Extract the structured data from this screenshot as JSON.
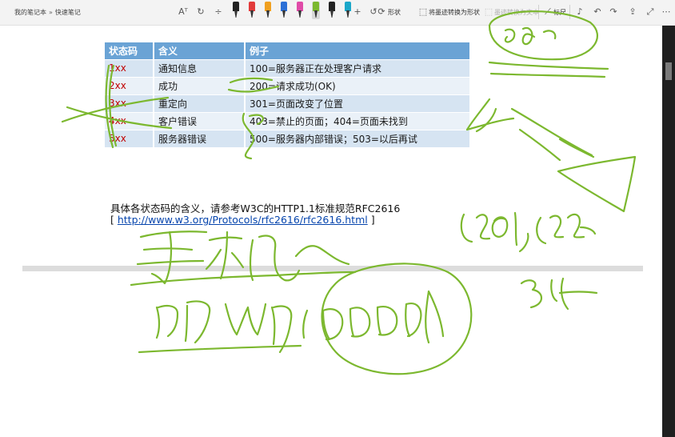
{
  "breadcrumb": {
    "notebook": "我的笔记本",
    "separator": "»",
    "section": "快速笔记"
  },
  "toolbar": {
    "shapes_label": "形状",
    "ink_to_shape_label": "将墨迹转换为形状",
    "ink_to_text_label": "墨迹转换为文本",
    "ruler_label": "标尺",
    "pens": [
      {
        "color": "#222222"
      },
      {
        "color": "#e23b3b"
      },
      {
        "color": "#f0a020"
      },
      {
        "color": "#2b6fd6"
      },
      {
        "color": "#e04ba8"
      },
      {
        "color": "#7cb82f"
      },
      {
        "color": "#222222"
      },
      {
        "color": "#1ba7c9"
      }
    ],
    "selected_pen": 5
  },
  "table": {
    "headers": [
      "状态码",
      "含义",
      "例子"
    ],
    "rows": [
      [
        "1xx",
        "通知信息",
        "100=服务器正在处理客户请求"
      ],
      [
        "2xx",
        "成功",
        "200=请求成功(OK)"
      ],
      [
        "3xx",
        "重定向",
        "301=页面改变了位置"
      ],
      [
        "4xx",
        "客户错误",
        "403=禁止的页面；404=页面未找到"
      ],
      [
        "5xx",
        "服务器错误",
        "500=服务器内部错误；503=以后再试"
      ]
    ]
  },
  "reference": {
    "text": "具体各状态码的含义，请参考W3C的HTTP1.1标准规范RFC2616",
    "link_open": "[ ",
    "link": "http://www.w3.org/Protocols/rfc2616/rfc2616.html",
    "link_close": " ]"
  },
  "ink_color": "#7cb82f"
}
